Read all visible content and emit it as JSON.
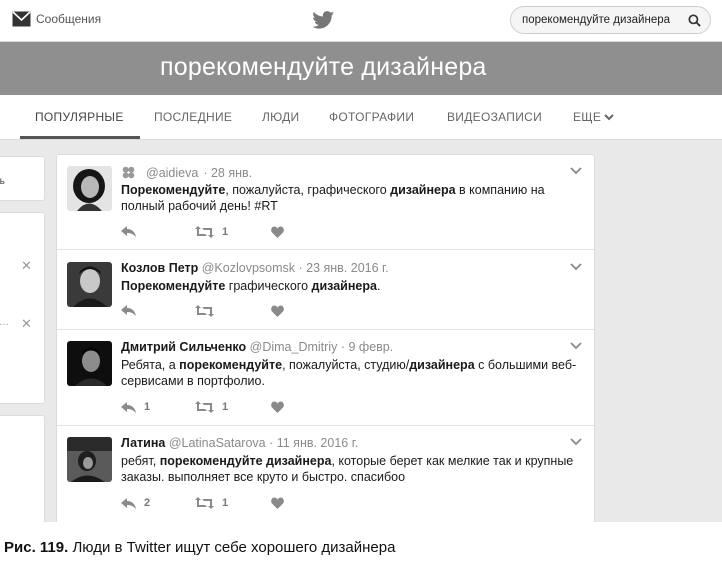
{
  "topbar": {
    "messages_label": "Сообщения",
    "search_value": "порекомендуйте дизайнера"
  },
  "banner": {
    "title": "порекомендуйте дизайнера"
  },
  "tabs": [
    {
      "label": "ПОПУЛЯРНЫЕ",
      "active": true
    },
    {
      "label": "ПОСЛЕДНИЕ"
    },
    {
      "label": "ЛЮДИ"
    },
    {
      "label": "ФОТОГРАФИИ"
    },
    {
      "label": "ВИДЕОЗАПИСИ"
    },
    {
      "label": "ЕЩЕ"
    }
  ],
  "left_panel": {
    "cut_text": "ть"
  },
  "tweets": [
    {
      "name": "",
      "handle": "@aidieva",
      "date": "· 28 янв.",
      "text_parts": [
        {
          "b": "Порекомендуйте"
        },
        {
          "t": ", пожалуйста, графического "
        },
        {
          "b": "дизайнера"
        },
        {
          "t": " в компанию на полный рабочий день! #RT"
        }
      ],
      "replies": "",
      "retweets": "1"
    },
    {
      "name": "Козлов Петр",
      "handle": "@Kozlovpsomsk",
      "date": "· 23 янв. 2016 г.",
      "text_parts": [
        {
          "b": "Порекомендуйте"
        },
        {
          "t": " графического "
        },
        {
          "b": "дизайнера"
        },
        {
          "t": "."
        }
      ],
      "replies": "",
      "retweets": ""
    },
    {
      "name": "Дмитрий Сильченко",
      "handle": "@Dima_Dmitriy",
      "date": "· 9 февр.",
      "text_parts": [
        {
          "t": "Ребята, а "
        },
        {
          "b": "порекомендуйте"
        },
        {
          "t": ", пожалуйста, студию/"
        },
        {
          "b": "дизайнера"
        },
        {
          "t": " с большими веб-сервисами в портфолио."
        }
      ],
      "replies": "1",
      "retweets": "1"
    },
    {
      "name": "Латина",
      "handle": "@LatinaSatarova",
      "date": "· 11 янв. 2016 г.",
      "text_parts": [
        {
          "t": "ребят, "
        },
        {
          "b": "порекомендуйте дизайнера"
        },
        {
          "t": ", которые берет как мелкие так и крупные заказы. выполняет все круто и быстро. спасибоо"
        }
      ],
      "replies": "2",
      "retweets": "1"
    }
  ],
  "caption": {
    "label": "Рис. 119.",
    "text": "Люди в Twitter ищут себе хорошего дизайнера"
  }
}
